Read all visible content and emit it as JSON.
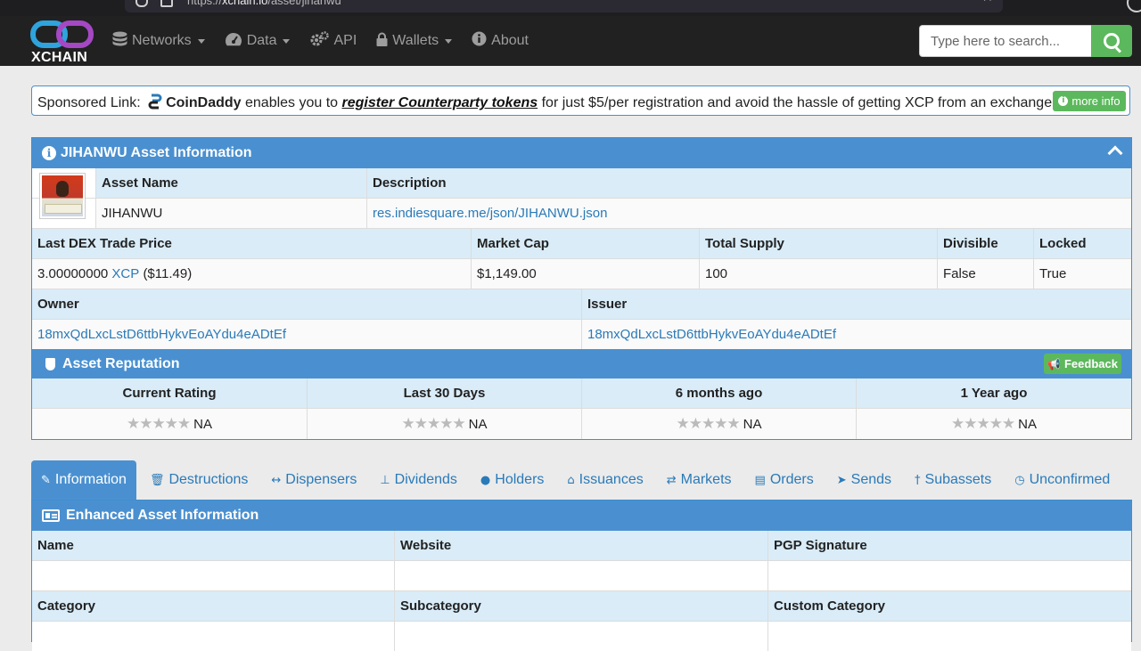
{
  "browser": {
    "url_prefix": "https://",
    "url_host": "xchain.io",
    "url_path": "/asset/jihanwu"
  },
  "nav": {
    "logo_text": "XCHAIN",
    "items": [
      {
        "label": "Networks",
        "icon": "database-icon",
        "dropdown": true
      },
      {
        "label": "Data",
        "icon": "dashboard-icon",
        "dropdown": true
      },
      {
        "label": "API",
        "icon": "gears-icon",
        "dropdown": false
      },
      {
        "label": "Wallets",
        "icon": "lock-icon",
        "dropdown": true
      },
      {
        "label": "About",
        "icon": "info-icon",
        "dropdown": false
      }
    ],
    "search_placeholder": "Type here to search..."
  },
  "sponsored": {
    "prefix": "Sponsored Link:",
    "brand": "CoinDaddy",
    "middle": "enables you to",
    "link": "register Counterparty tokens",
    "suffix": "for just $5/per registration and avoid the hassle of getting XCP from an exchange!",
    "button": "more info"
  },
  "asset_panel": {
    "title": "JIHANWU Asset Information",
    "headers1": {
      "name": "Asset Name",
      "description": "Description"
    },
    "values1": {
      "name": "JIHANWU",
      "description": "res.indiesquare.me/json/JIHANWU.json"
    },
    "headers2": {
      "price": "Last DEX Trade Price",
      "market_cap": "Market Cap",
      "supply": "Total Supply",
      "divisible": "Divisible",
      "locked": "Locked"
    },
    "values2": {
      "price_num": "3.00000000",
      "price_unit": "XCP",
      "price_usd": "($11.49)",
      "market_cap": "$1,149.00",
      "supply": "100",
      "divisible": "False",
      "locked": "True"
    },
    "headers3": {
      "owner": "Owner",
      "issuer": "Issuer"
    },
    "values3": {
      "owner": "18mxQdLxcLstD6ttbHykvEoAYdu4eADtEf",
      "issuer": "18mxQdLxcLstD6ttbHykvEoAYdu4eADtEf"
    }
  },
  "reputation": {
    "title": "Asset Reputation",
    "button": "Feedback",
    "columns": [
      "Current Rating",
      "Last 30 Days",
      "6 months ago",
      "1 Year ago"
    ],
    "values": [
      "NA",
      "NA",
      "NA",
      "NA"
    ],
    "stars": "★★★★★"
  },
  "tabs": [
    {
      "label": "Information",
      "icon": "✎",
      "active": true
    },
    {
      "label": "Destructions",
      "icon": "🗑",
      "active": false
    },
    {
      "label": "Dispensers",
      "icon": "↔",
      "active": false
    },
    {
      "label": "Dividends",
      "icon": "⊥",
      "active": false
    },
    {
      "label": "Holders",
      "icon": "●",
      "active": false
    },
    {
      "label": "Issuances",
      "icon": "⌂",
      "active": false
    },
    {
      "label": "Markets",
      "icon": "⇄",
      "active": false
    },
    {
      "label": "Orders",
      "icon": "▤",
      "active": false
    },
    {
      "label": "Sends",
      "icon": "➤",
      "active": false
    },
    {
      "label": "Subassets",
      "icon": "†",
      "active": false
    },
    {
      "label": "Unconfirmed",
      "icon": "◷",
      "active": false
    }
  ],
  "enhanced": {
    "title": "Enhanced Asset Information",
    "headers1": [
      "Name",
      "Website",
      "PGP Signature"
    ],
    "headers2": [
      "Category",
      "Subcategory",
      "Custom Category"
    ]
  },
  "colors": {
    "accent": "#4a90d0",
    "success": "#5cb85c",
    "navbar": "#212121",
    "header_row": "#d9ecf8"
  }
}
